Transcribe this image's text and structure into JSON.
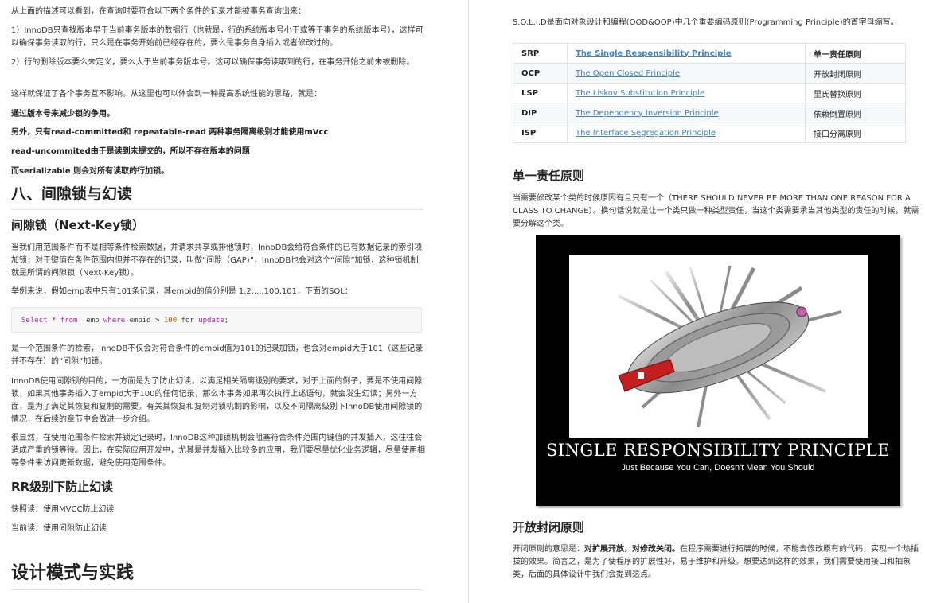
{
  "left": {
    "p_intro": "从上面的描述可以看到，在查询时要符合以下两个条件的记录才能被事务查询出来：",
    "p_cond1": "1）InnoDB只查找版本早于当前事务版本的数据行（也就是，行的系统版本号小于或等于事务的系统版本号），这样可以确保事务读取的行，只么是在事务开始前已经存在的，要么是事务自身插入或者修改过的。",
    "p_cond2": "2）行的删除版本要么未定义，要么大于当前事务版本号。这可以确保事务读取到的行，在事务开始之前未被删除。",
    "p_ensure": "这样就保证了各个事务互不影响。从这里也可以体会到一种提高系统性能的思路，就是：",
    "b_line1": "通过版本号来减少锁的争用。",
    "b_line2": "另外，只有read-committed和 repeatable-read 两种事务隔离级别才能使用mVcc",
    "b_line3": "read-uncommited由于是读到未提交的，所以不存在版本的问题",
    "b_line4": "而serializable 则会对所有读取的行加锁。",
    "h_gap": "八、间隙锁与幻读",
    "h_nextkey": "间隙锁（Next-Key锁）",
    "p_gap_desc": "当我们用范围条件而不是相等条件检索数据，并请求共享或排他锁时，InnoDB会给符合条件的已有数据记录的索引项加锁；对于键值在条件范围内但并不存在的记录，叫做“间隙（GAP)”，InnoDB也会对这个“间隙”加锁，这种锁机制就是所谓的间隙锁（Next-Key锁）。",
    "p_example": "举例来说，假如emp表中只有101条记录，其empid的值分别是 1,2,...,100,101，下面的SQL：",
    "code": {
      "t1": "Select",
      "t2": " * ",
      "t3": "from",
      "t4": "  emp ",
      "t5": "where",
      "t6": " empid > ",
      "t7": "100",
      "t8": " for ",
      "t9": "update",
      "t10": ";"
    },
    "p_range": "是一个范围条件的检索，InnoDB不仅会对符合条件的empid值为101的记录加锁，也会对empid大于101（这些记录并不存在）的“间隙”加锁。",
    "p_purpose": "InnoDB使用间隙锁的目的，一方面是为了防止幻读，以满足相关隔离级别的要求，对于上面的例子，要是不使用间隙锁，如果其他事务插入了empid大于100的任何记录，那么本事务如果再次执行上述语句，就会发生幻读；另外一方面，是为了满足其恢复和复制的需要。有关其恢复和复制对锁机制的影响，以及不同隔离级别下InnoDB使用间隙锁的情况，在后续的章节中会做进一步介绍。",
    "p_obvious": "很显然，在使用范围条件检索并锁定记录时，InnoDB这种加锁机制会阻塞符合条件范围内键值的并发插入，这往往会造成严重的锁等待。因此，在实际应用开发中，尤其是并发插入比较多的应用，我们要尽量优化业务逻辑，尽量使用相等条件来访问更新数据，避免使用范围条件。",
    "h_rr": "RR级别下防止幻读",
    "p_snapshot": "快照读：使用MVCC防止幻读",
    "p_current": "当前读：使用间隙防止幻读",
    "h_design": "设计模式与实践"
  },
  "right": {
    "p_solid": "S.O.L.I.D是面向对象设计和编程(OOD&OOP)中几个重要编码原则(Programming Principle)的首字母缩写。",
    "principles": [
      {
        "abbr": "SRP",
        "name": "The Single Responsibility Principle ",
        "cn": "单一责任原则"
      },
      {
        "abbr": "OCP",
        "name": "The Open Closed Principle",
        "cn": "开放封闭原则"
      },
      {
        "abbr": "LSP",
        "name": "The Liskov Substitution Principle",
        "cn": "里氏替换原则"
      },
      {
        "abbr": "DIP",
        "name": "The Dependency Inversion Principle",
        "cn": "依赖倒置原则"
      },
      {
        "abbr": "ISP",
        "name": "The Interface Segregation Principle",
        "cn": "接口分离原则"
      }
    ],
    "h_srp": "单一责任原则",
    "p_srp": "当需要修改某个类的时候原因有且只有一个（THERE SHOULD NEVER BE MORE THAN ONE REASON FOR A CLASS TO CHANGE）。换句话说就是让一个类只做一种类型责任，当这个类需要承当其他类型的责任的时候，就需要分解这个类。",
    "poster_title": "SINGLE RESPONSIBILITY PRINCIPLE",
    "poster_sub": "Just Because You Can, Doesn't Mean You Should",
    "h_ocp": "开放封闭原则",
    "p_ocp_pre": "开闭原则的意思是：",
    "p_ocp_bold": "对扩展开放，对修改关闭。",
    "p_ocp_post": "在程序需要进行拓展的时候，不能去修改原有的代码，实现一个热插拔的效果。简言之，是为了使程序的扩展性好，易于维护和升级。想要达到这样的效果，我们需要使用接口和抽象类，后面的具体设计中我们会提到这点。"
  }
}
